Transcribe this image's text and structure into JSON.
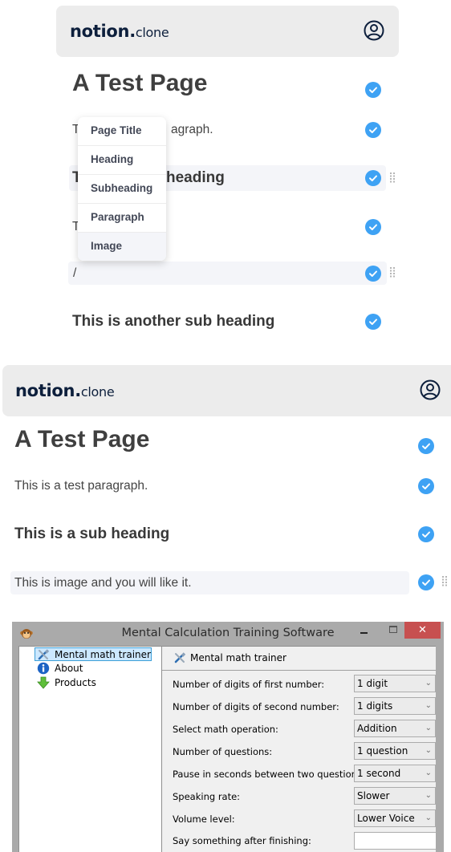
{
  "notion_top": {
    "brand_main": "notion.",
    "brand_sub": "clone",
    "blocks": [
      {
        "type": "title",
        "text": "A Test Page"
      },
      {
        "type": "para",
        "text": "This is a test paragraph."
      },
      {
        "type": "sub",
        "text": "This is a sub heading"
      },
      {
        "type": "para",
        "text": "This is image and you will like it."
      },
      {
        "type": "para",
        "text": "/"
      },
      {
        "type": "sub",
        "text": "This is another sub heading"
      }
    ],
    "visible_fragments": {
      "para1_fragment": "T",
      "para1_tail": "agraph.",
      "sub1_fragment": "T",
      "sub1_tail": "heading",
      "para2_fragment": "T",
      "slash": "/"
    },
    "block_menu": [
      "Page Title",
      "Heading",
      "Subheading",
      "Paragraph",
      "Image"
    ],
    "block_menu_highlighted": "Image"
  },
  "notion_bottom": {
    "brand_main": "notion.",
    "brand_sub": "clone",
    "blocks": [
      {
        "type": "title",
        "text": "A Test Page"
      },
      {
        "type": "para",
        "text": "This is a test paragraph."
      },
      {
        "type": "sub",
        "text": "This is a sub heading"
      },
      {
        "type": "para",
        "text": "This is image and you will like it."
      }
    ]
  },
  "colors": {
    "check_blue": "#3ea2f4",
    "navbar_bg": "#ececec",
    "brand_text": "#0d1f3c",
    "close_red": "#c75050"
  },
  "windows_app": {
    "title": "Mental Calculation Training Software",
    "close_glyph": "✕",
    "tree": [
      {
        "label": "Mental math trainer",
        "icon": "tools-icon",
        "selected": true
      },
      {
        "label": "About",
        "icon": "info-icon",
        "selected": false
      },
      {
        "label": "Products",
        "icon": "download-arrow-icon",
        "selected": false
      }
    ],
    "panel_header": "Mental math trainer",
    "settings": [
      {
        "label": "Number of digits of first number:",
        "value": "1 digit",
        "kind": "combo"
      },
      {
        "label": "Number of digits of second number:",
        "value": "1 digits",
        "kind": "combo"
      },
      {
        "label": "Select math operation:",
        "value": "Addition",
        "kind": "combo"
      },
      {
        "label": "Number of questions:",
        "value": "1 question",
        "kind": "combo"
      },
      {
        "label": "Pause in seconds between two questions:",
        "value": "1 second",
        "kind": "combo"
      },
      {
        "label": "Speaking rate:",
        "value": "Slower",
        "kind": "combo"
      },
      {
        "label": "Volume level:",
        "value": "Lower Voice",
        "kind": "combo"
      },
      {
        "label": "Say something after finishing:",
        "value": "",
        "kind": "text"
      }
    ],
    "combo_arrow": "⌄"
  }
}
